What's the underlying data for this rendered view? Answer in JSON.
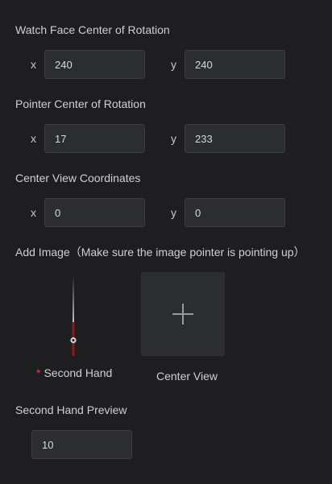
{
  "watch_face_center": {
    "label": "Watch Face Center of Rotation",
    "x_label": "x",
    "x_value": "240",
    "y_label": "y",
    "y_value": "240"
  },
  "pointer_center": {
    "label": "Pointer Center of Rotation",
    "x_label": "x",
    "x_value": "17",
    "y_label": "y",
    "y_value": "233"
  },
  "center_view_coords": {
    "label": "Center View Coordinates",
    "x_label": "x",
    "x_value": "0",
    "y_label": "y",
    "y_value": "0"
  },
  "add_image": {
    "label": "Add Image（Make sure the image pointer is pointing up）",
    "second_hand": {
      "required_mark": "*",
      "caption": "Second Hand",
      "needle_color": "#8b1a1a",
      "tip_color": "#e8e8e8"
    },
    "center_view": {
      "caption": "Center View",
      "icon": "plus-icon"
    }
  },
  "second_hand_preview": {
    "label": "Second Hand Preview",
    "value": "10"
  },
  "colors": {
    "background": "#1e1e20",
    "field_bg": "#2c2d30",
    "required": "#e04040"
  }
}
